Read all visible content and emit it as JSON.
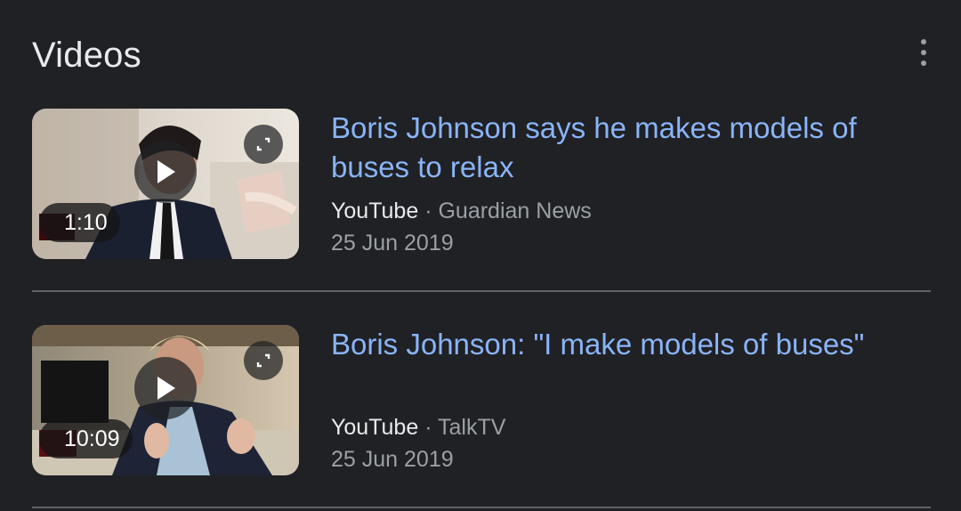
{
  "section": {
    "title": "Videos",
    "more_icon": "more-vert-icon"
  },
  "videos": [
    {
      "title": "Boris Johnson says he makes models of buses to relax",
      "source": "YouTube",
      "separator": " · ",
      "channel": "Guardian News",
      "date": "25 Jun 2019",
      "duration": "1:10",
      "play_icon": "play-icon",
      "expand_icon": "expand-icon"
    },
    {
      "title": "Boris Johnson: \"I make models of buses\"",
      "source": "YouTube",
      "separator": " · ",
      "channel": "TalkTV",
      "date": "25 Jun 2019",
      "duration": "10:09",
      "play_icon": "play-icon",
      "expand_icon": "expand-icon"
    }
  ],
  "colors": {
    "background": "#202124",
    "link": "#8ab4f8",
    "text_primary": "#e8eaed",
    "text_secondary": "#9aa0a6",
    "divider": "#5f6368"
  }
}
